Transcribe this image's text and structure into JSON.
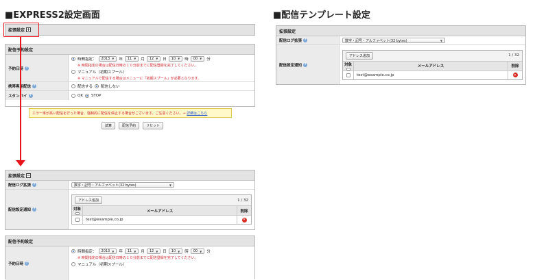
{
  "left_title": "■EXPRESS2設定画面",
  "right_title": "■配信テンプレート設定",
  "ext_settings": {
    "label": "拡張設定",
    "expand_icon": "+",
    "collapse_icon": "−"
  },
  "schedule": {
    "header": "配信予約設定",
    "datetime_label": "予約日時",
    "time_radio_label": "時間指定：",
    "year": "2013",
    "year_unit": "年",
    "month": "11",
    "month_unit": "月",
    "day": "12",
    "day_unit": "日",
    "hour": "10",
    "hour_unit": "時",
    "minute": "00",
    "minute_unit": "分",
    "note1": "※ 時間指定の場合は配信日時の１０分前までに配信登録を完了してください。",
    "manual_label": "マニュアル（初期スプール）",
    "note2": "※ マニュアルで配信する場合はメニューに「初期スプール」が必要となります。",
    "mobile_label": "携帯専用配信",
    "mobile_opt1": "配信する",
    "mobile_opt2": "配信しない",
    "standby_label": "スタンバイ",
    "standby_opt1": "OK",
    "standby_opt2": "STOP"
  },
  "warning": {
    "text": "エラー率が高い配信を行った場合、強制的に配信を停止する場合がございます。ご注意ください。→",
    "link": "詳細はこちら"
  },
  "buttons": {
    "test": "試算",
    "reserve": "配信予約",
    "reset": "リセット"
  },
  "log_section": {
    "log_label": "配信ログ拡張",
    "log_value": "数字・記号・アルファベット(32 bytes)",
    "notify_label": "配信設定通知",
    "add_button": "アドレス追加",
    "count": "1 / 32",
    "col_target": "対象",
    "col_mail": "メールアドレス",
    "col_delete": "削除",
    "email": "test@example.co.jp"
  },
  "colors": {
    "accent_red": "#e8141c",
    "note_red": "#d1222a"
  }
}
